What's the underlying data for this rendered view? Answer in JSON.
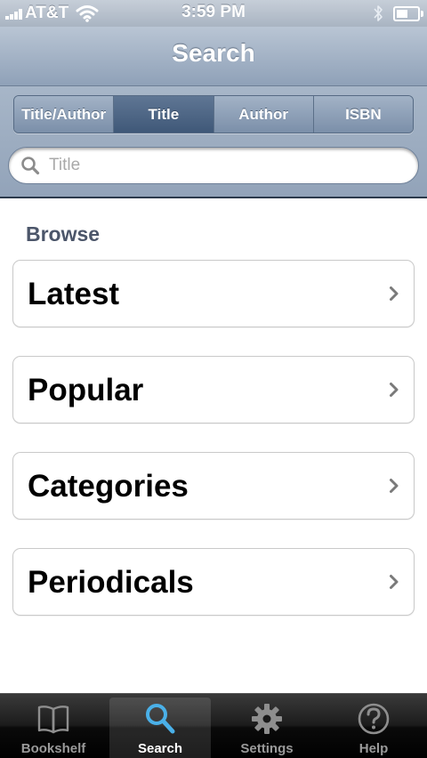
{
  "status_bar": {
    "carrier": "AT&T",
    "time": "3:59 PM",
    "battery_level": 0.55,
    "signal_bars": 4,
    "icons": [
      "signal-icon",
      "wifi-icon",
      "bluetooth-icon",
      "battery-icon"
    ]
  },
  "nav": {
    "title": "Search"
  },
  "search": {
    "segments": [
      {
        "label": "Title/Author",
        "selected": false
      },
      {
        "label": "Title",
        "selected": true
      },
      {
        "label": "Author",
        "selected": false
      },
      {
        "label": "ISBN",
        "selected": false
      }
    ],
    "value": "",
    "placeholder": "Title",
    "icon": "search-icon"
  },
  "browse": {
    "heading": "Browse",
    "items": [
      {
        "label": "Latest",
        "icon": "chevron-right-icon"
      },
      {
        "label": "Popular",
        "icon": "chevron-right-icon"
      },
      {
        "label": "Categories",
        "icon": "chevron-right-icon"
      },
      {
        "label": "Periodicals",
        "icon": "chevron-right-icon"
      }
    ]
  },
  "tabs": [
    {
      "label": "Bookshelf",
      "icon": "book-icon",
      "selected": false
    },
    {
      "label": "Search",
      "icon": "search-icon",
      "selected": true
    },
    {
      "label": "Settings",
      "icon": "gear-icon",
      "selected": false
    },
    {
      "label": "Help",
      "icon": "help-icon",
      "selected": false
    }
  ],
  "colors": {
    "nav_blue": "#a4b3c6",
    "segment_selected": "#4d6585",
    "tab_selected_icon": "#4ab0e8",
    "tab_inactive": "#9a9a9a",
    "browse_heading": "#4c566a"
  }
}
